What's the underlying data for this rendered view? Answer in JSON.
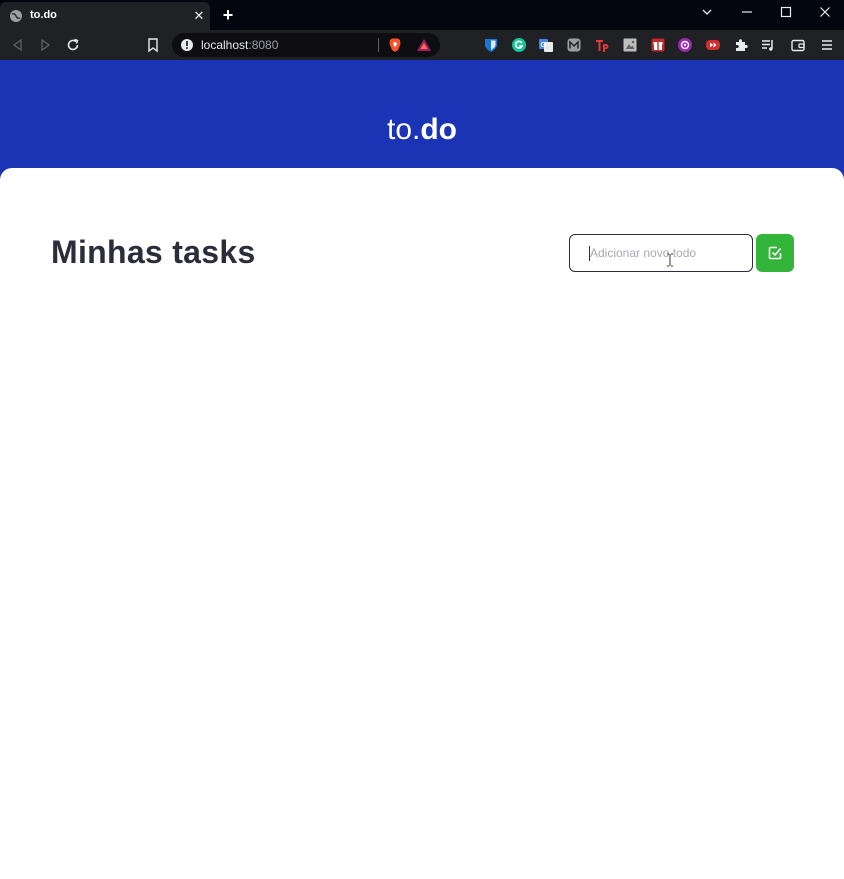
{
  "browser": {
    "tab": {
      "title": "to.do"
    },
    "address": {
      "host": "localhost",
      "port": ":8080"
    },
    "extensions": [
      {
        "name": "bitwarden-icon",
        "color": "#1976d2"
      },
      {
        "name": "grammarly-icon",
        "color": "#15c39a"
      },
      {
        "name": "translate-icon",
        "color": "#4285f4"
      },
      {
        "name": "extension-m-icon",
        "color": "#9e9e9e"
      },
      {
        "name": "tp-icon",
        "color": "#e53935"
      },
      {
        "name": "image-ext-icon",
        "color": "#bdbdbd"
      },
      {
        "name": "gift-icon",
        "color": "#e53935"
      },
      {
        "name": "purple-ext-icon",
        "color": "#9c27b0"
      },
      {
        "name": "media-ext-icon",
        "color": "#d32f2f"
      }
    ]
  },
  "app": {
    "brand_light": "to.",
    "brand_bold": "do",
    "title": "Minhas tasks",
    "input": {
      "placeholder": "Adicionar novo todo",
      "value": ""
    },
    "colors": {
      "header": "#1a34b5",
      "accent": "#33b53a",
      "text": "#2c2c3a"
    }
  }
}
